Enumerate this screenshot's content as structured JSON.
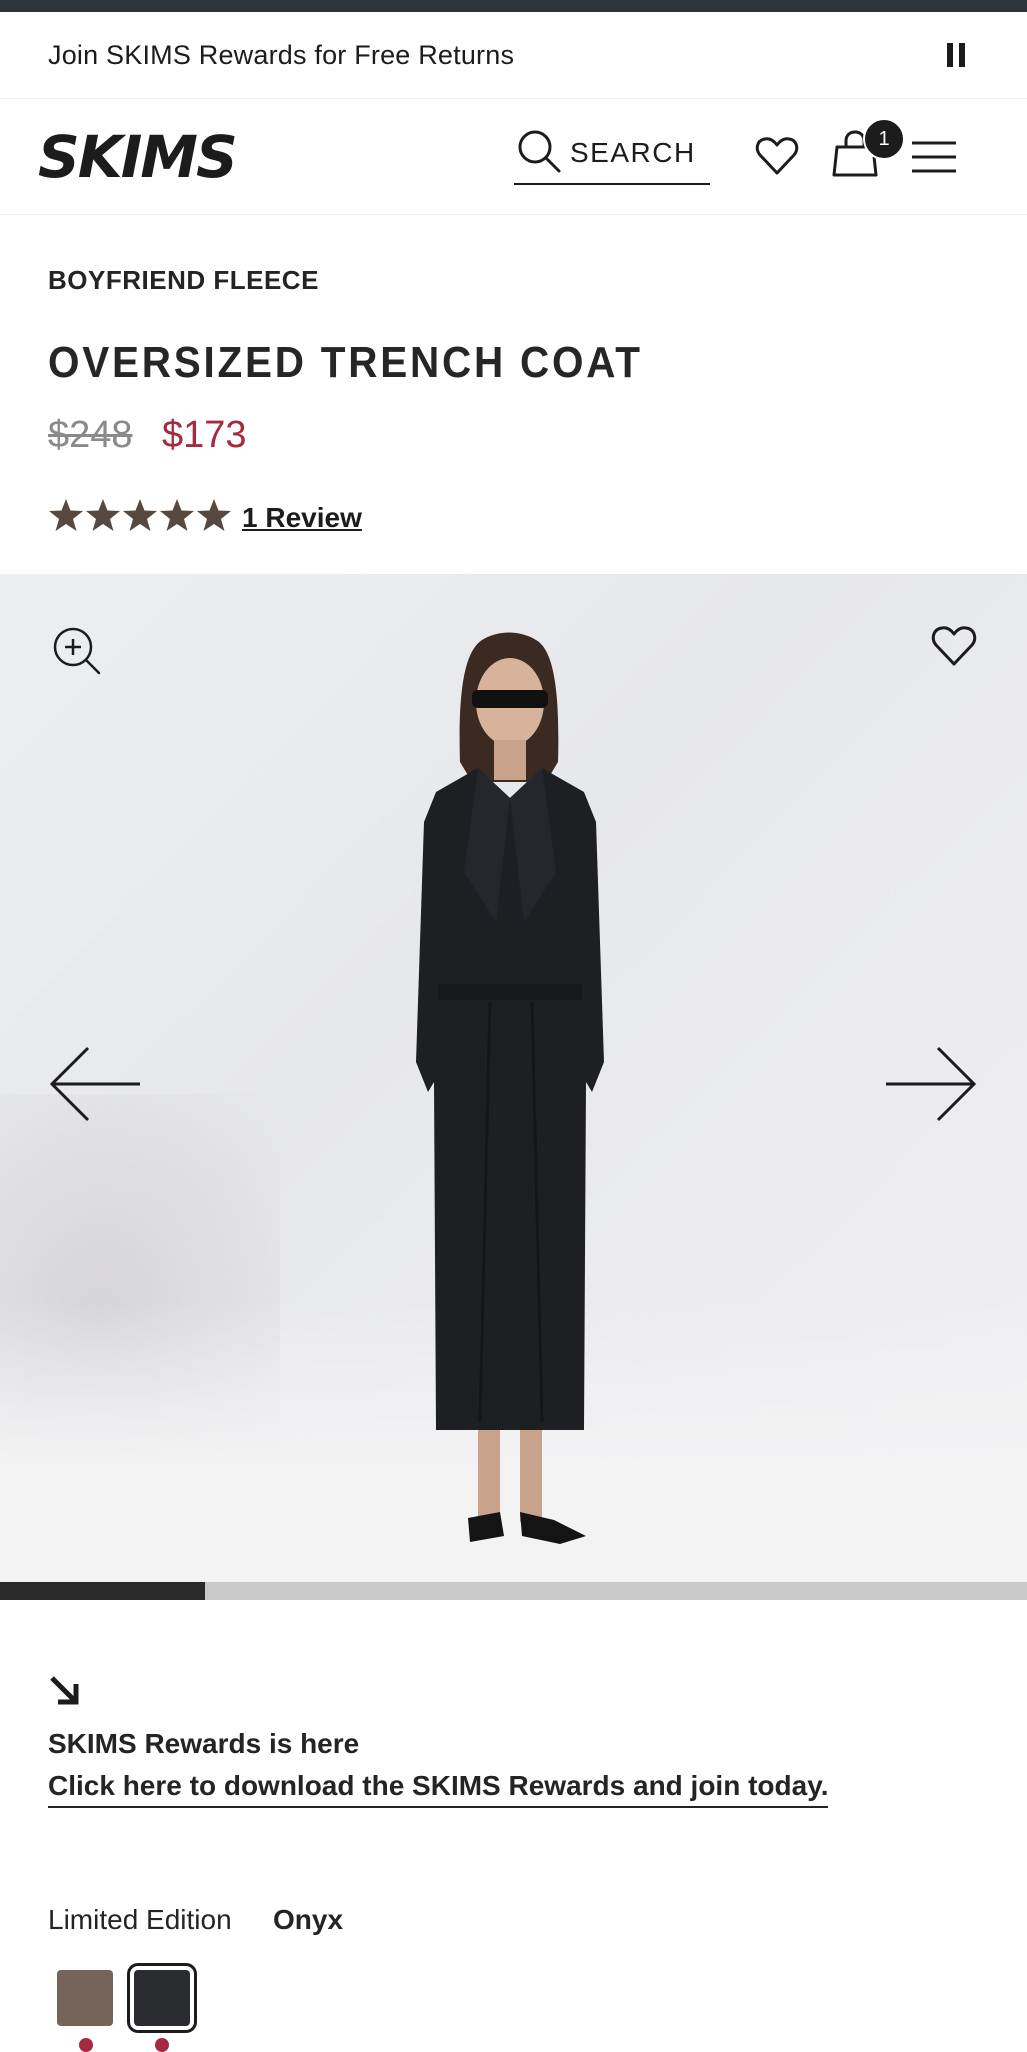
{
  "promo": {
    "text": "Join SKIMS Rewards for Free Returns"
  },
  "header": {
    "logo_text": "SKIMS",
    "search_label": "SEARCH",
    "cart_count": "1"
  },
  "product": {
    "collection": "BOYFRIEND FLEECE",
    "title": "OVERSIZED TRENCH COAT",
    "price_original": "$248",
    "price_sale": "$173",
    "rating": 5,
    "review_link": "1 Review"
  },
  "gallery": {
    "progress": 0.2
  },
  "rewards": {
    "title": "SKIMS Rewards is here",
    "link": "Click here to download the SKIMS Rewards and join today."
  },
  "color": {
    "edition_label": "Limited Edition",
    "selected_name": "Onyx",
    "swatches": [
      "#76635a",
      "#2b2c2f"
    ]
  },
  "colors": {
    "sale": "#a52a3f",
    "topbar": "#2d3338",
    "text": "#1c1c1c"
  }
}
